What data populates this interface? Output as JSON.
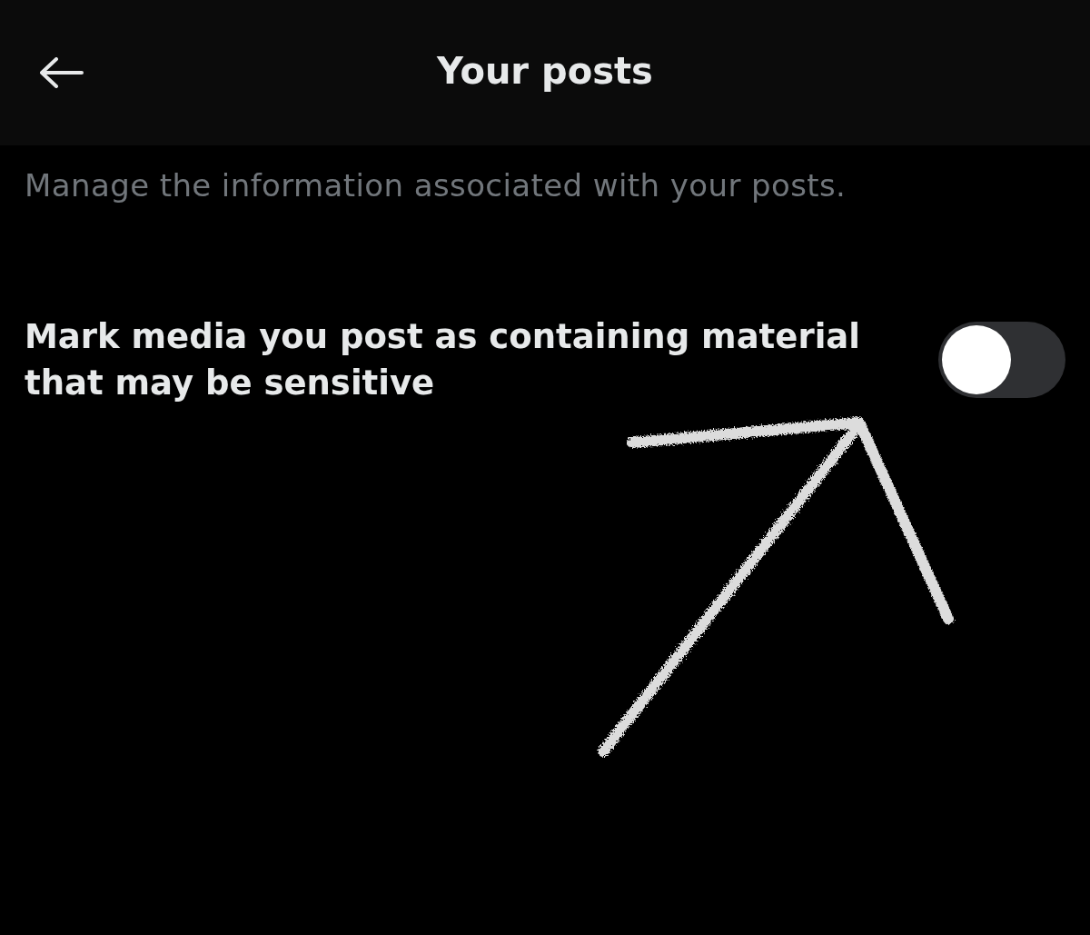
{
  "header": {
    "title": "Your posts"
  },
  "description": "Manage the information associated with your posts.",
  "settings": [
    {
      "label": "Mark media you post as containing material that may be sensitive",
      "on": false
    }
  ]
}
